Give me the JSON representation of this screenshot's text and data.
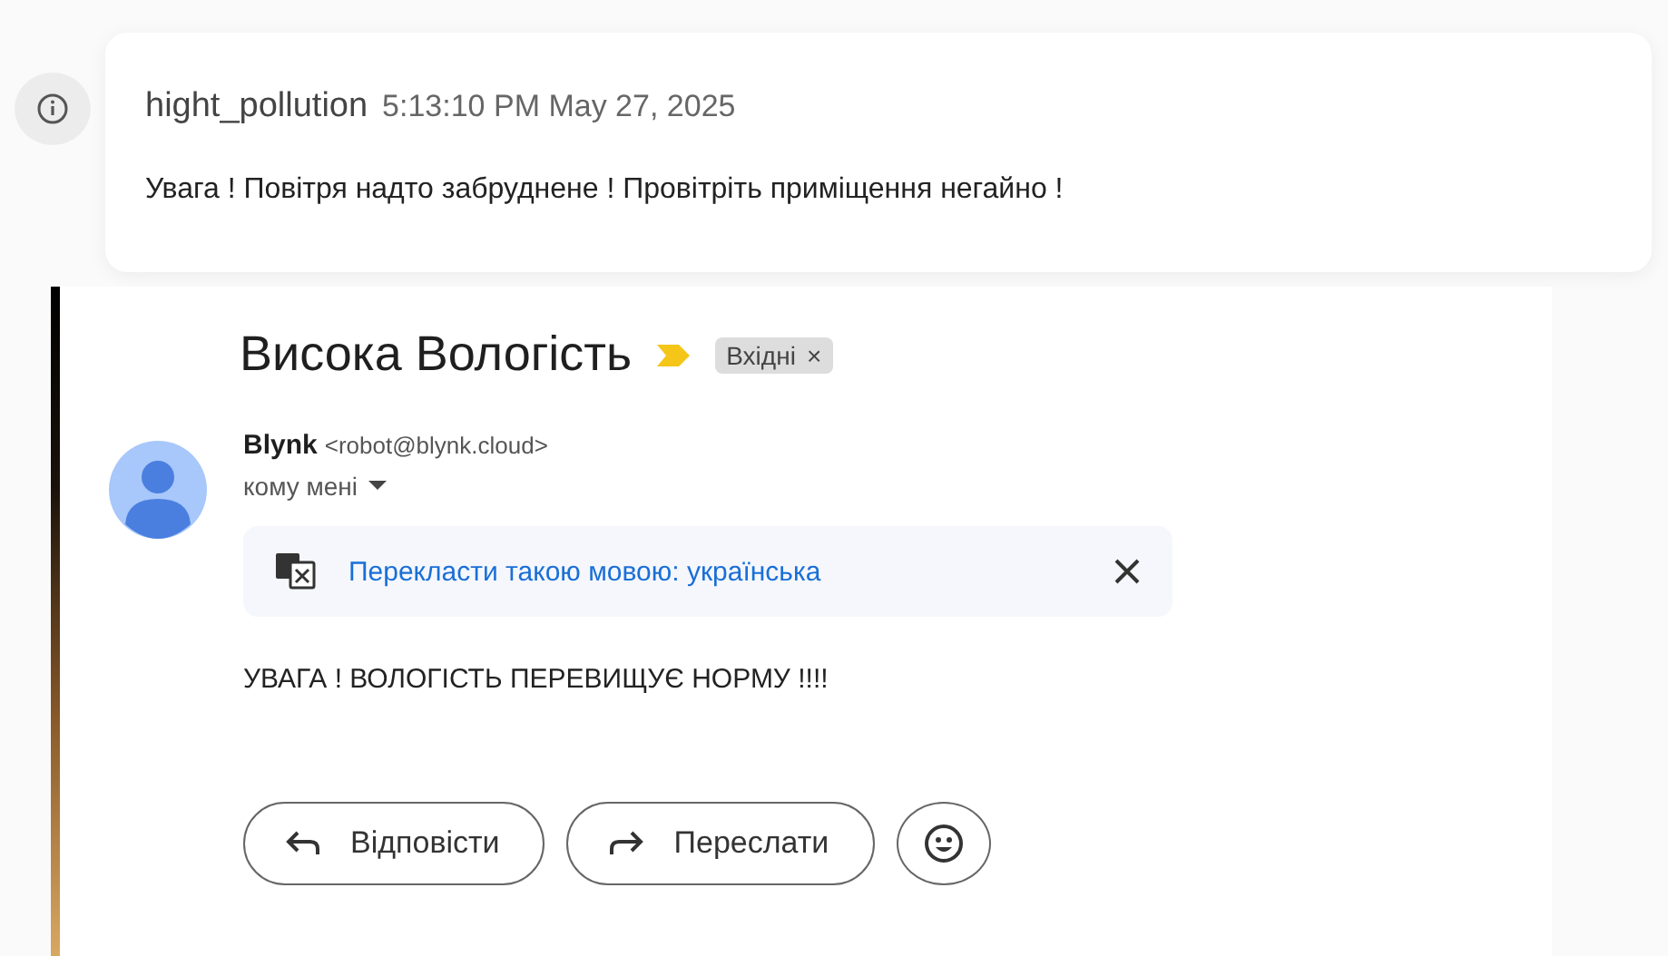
{
  "notification": {
    "event": "hight_pollution",
    "timestamp": "5:13:10 PM May 27, 2025",
    "message": "Увага ! Повітря надто забруднене ! Провітріть приміщення негайно !"
  },
  "email": {
    "subject": "Висока Вологість",
    "important": true,
    "label": {
      "text": "Вхідні",
      "close": "×"
    },
    "sender": {
      "name": "Blynk",
      "address": "<robot@blynk.cloud>"
    },
    "recipient": "кому мені",
    "translate": {
      "text": "Перекласти такою мовою: українська"
    },
    "body": "УВАГА ! ВОЛОГІСТЬ ПЕРЕВИЩУЄ НОРМУ !!!!",
    "actions": [
      {
        "kind": "reply",
        "label": "Відповісти"
      },
      {
        "kind": "forward",
        "label": "Переслати"
      },
      {
        "kind": "emoji"
      }
    ]
  }
}
